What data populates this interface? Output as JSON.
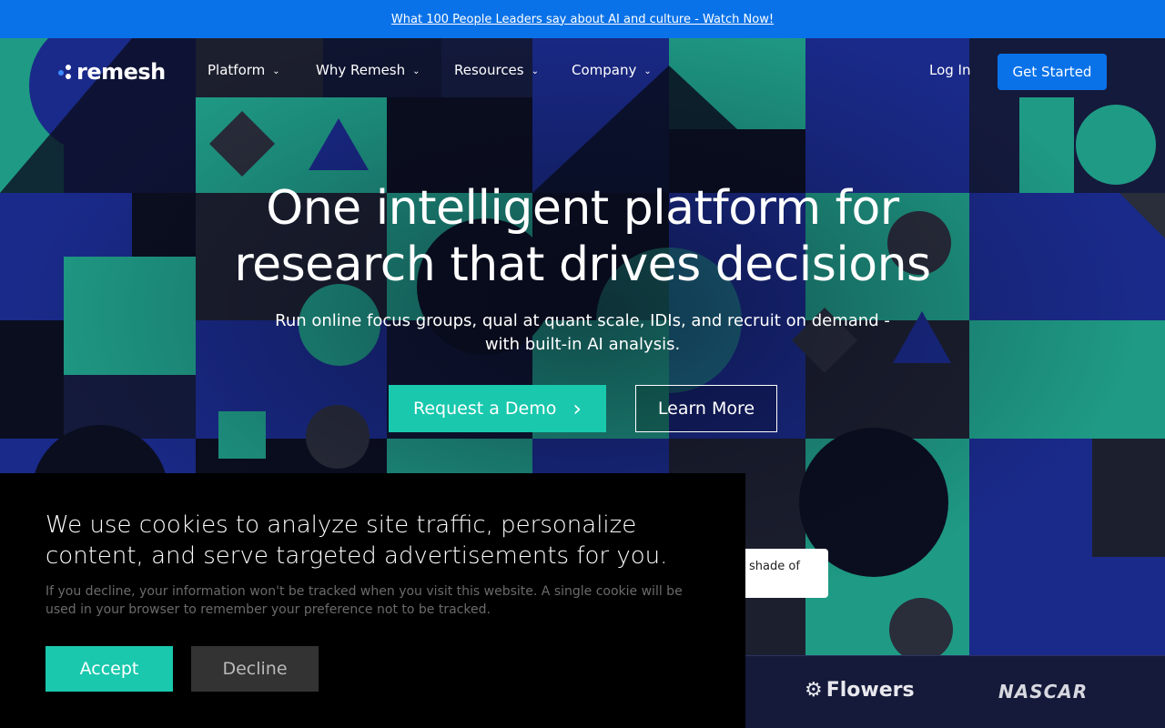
{
  "announcement": {
    "text": "What 100 People Leaders say about AI and culture - Watch Now!"
  },
  "brand": {
    "name": "remesh",
    "accent": "#0a72e8",
    "teal": "#19c8ad"
  },
  "nav": {
    "items": [
      {
        "label": "Platform",
        "icon": "chevron-down-icon"
      },
      {
        "label": "Why Remesh",
        "icon": "chevron-down-icon"
      },
      {
        "label": "Resources",
        "icon": "chevron-down-icon"
      },
      {
        "label": "Company",
        "icon": "chevron-down-icon"
      }
    ],
    "login_label": "Log In",
    "cta_label": "Get Started"
  },
  "hero": {
    "headline_line1": "One intelligent platform for",
    "headline_line2": "research that drives decisions",
    "subline_line1": "Run online focus groups, qual at quant scale, IDIs, and recruit on demand -",
    "subline_line2": "with built-in AI analysis.",
    "demo_label": "Request a Demo",
    "learn_label": "Learn More"
  },
  "tooltip": {
    "text": "shade of"
  },
  "logos": {
    "flowers": "Flowers",
    "nascar": "NASCAR"
  },
  "cookie": {
    "title": "We use cookies to analyze site traffic, personalize content, and serve targeted advertisements for you.",
    "body": "If you decline, your information won't be tracked when you visit this website. A single cookie will be used in your browser to remember your preference not to be tracked.",
    "accept_label": "Accept",
    "decline_label": "Decline"
  }
}
